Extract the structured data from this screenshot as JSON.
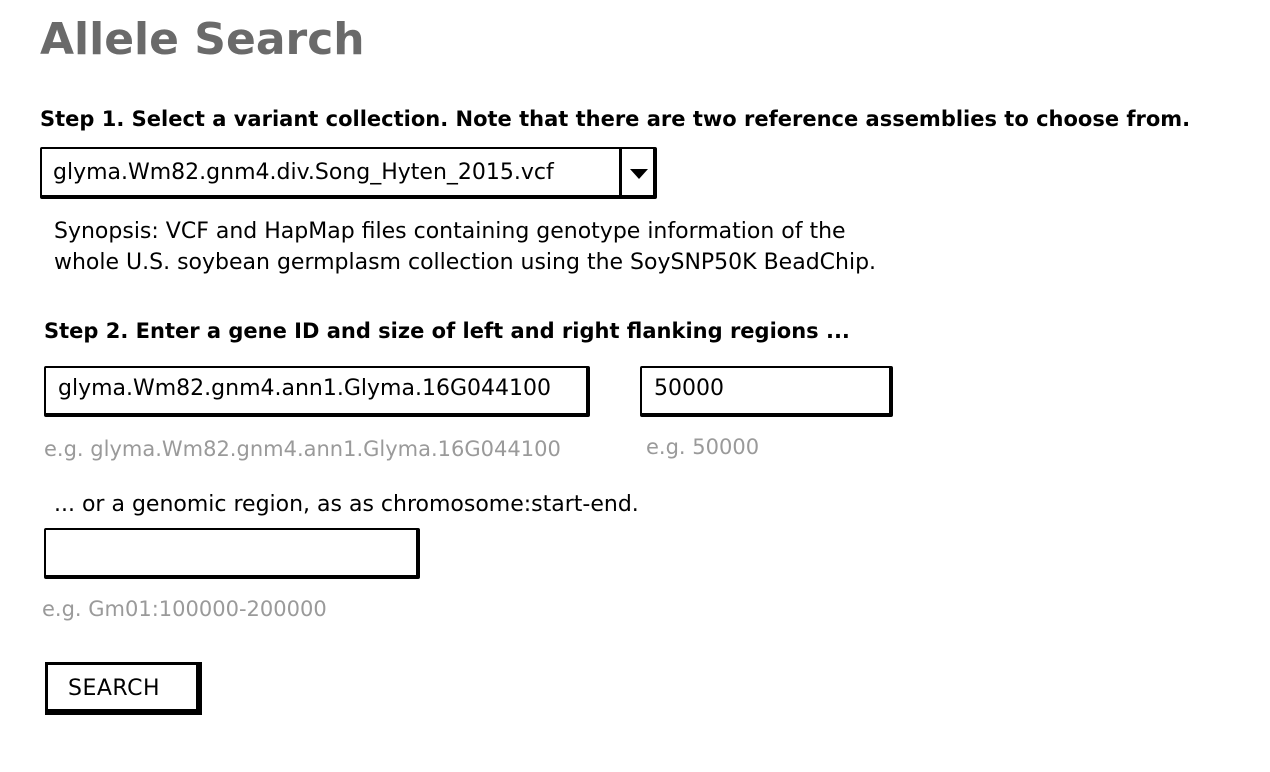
{
  "page": {
    "title": "Allele Search"
  },
  "step1": {
    "heading": "Step 1. Select a variant collection. Note that there are two reference assemblies to choose from.",
    "collection_select": {
      "selected": "glyma.Wm82.gnm4.div.Song_Hyten_2015.vcf",
      "icon": "chevron-down-icon"
    },
    "synopsis_line1": "Synopsis: VCF and HapMap files containing genotype information of the",
    "synopsis_line2": "whole U.S. soybean germplasm collection using the SoySNP50K BeadChip."
  },
  "step2": {
    "heading": "Step 2. Enter a gene ID and size of left and right flanking regions ...",
    "gene_input": {
      "value": "glyma.Wm82.gnm4.ann1.Glyma.16G044100",
      "hint": "e.g. glyma.Wm82.gnm4.ann1.Glyma.16G044100"
    },
    "flank_input": {
      "value": "50000",
      "hint": "e.g. 50000"
    },
    "region_label": "... or a genomic region, as as chromosome:start-end.",
    "region_input": {
      "value": "",
      "hint": "e.g. Gm01:100000-200000"
    }
  },
  "actions": {
    "search_label": "SEARCH"
  }
}
